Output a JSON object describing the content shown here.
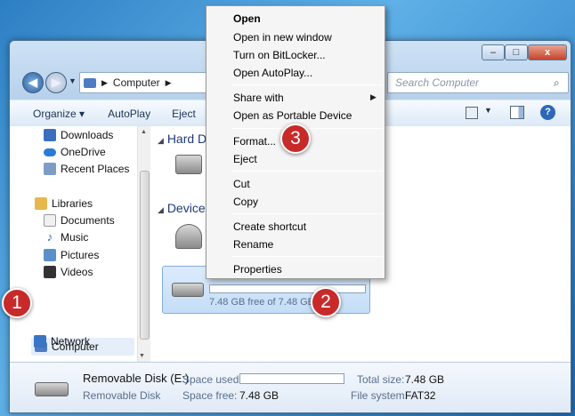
{
  "window": {
    "controls": [
      "–",
      "□",
      "x"
    ],
    "breadcrumb": "Computer",
    "search_placeholder": "Search Computer"
  },
  "toolbar": {
    "items": [
      "Organize ▾",
      "AutoPlay",
      "Eject",
      "»"
    ]
  },
  "nav": {
    "favorites": [
      "Downloads",
      "OneDrive",
      "Recent Places"
    ],
    "libraries_header": "Libraries",
    "libraries": [
      "Documents",
      "Music",
      "Pictures",
      "Videos"
    ],
    "computer": "Computer",
    "network": "Network"
  },
  "main": {
    "group_hard": "Hard D",
    "group_devices": "Device",
    "selected_drive_free": "7.48 GB free of 7.48 GB"
  },
  "menu": {
    "items": [
      "Open",
      "Open in new window",
      "Turn on BitLocker...",
      "Open AutoPlay...",
      "Share with",
      "Open as Portable Device",
      "Format...",
      "Eject",
      "Cut",
      "Copy",
      "Create shortcut",
      "Rename",
      "Properties"
    ]
  },
  "details": {
    "name": "Removable Disk (E:)",
    "type": "Removable Disk",
    "space_used_label": "Space used:",
    "space_free_label": "Space free:",
    "space_free_value": "7.48 GB",
    "total_size_label": "Total size:",
    "total_size_value": "7.48 GB",
    "file_system_label": "File system:",
    "file_system_value": "FAT32"
  },
  "badges": [
    "1",
    "2",
    "3"
  ],
  "colors": {
    "badge": "#c82a2a",
    "selection": "#cfe3f9"
  }
}
